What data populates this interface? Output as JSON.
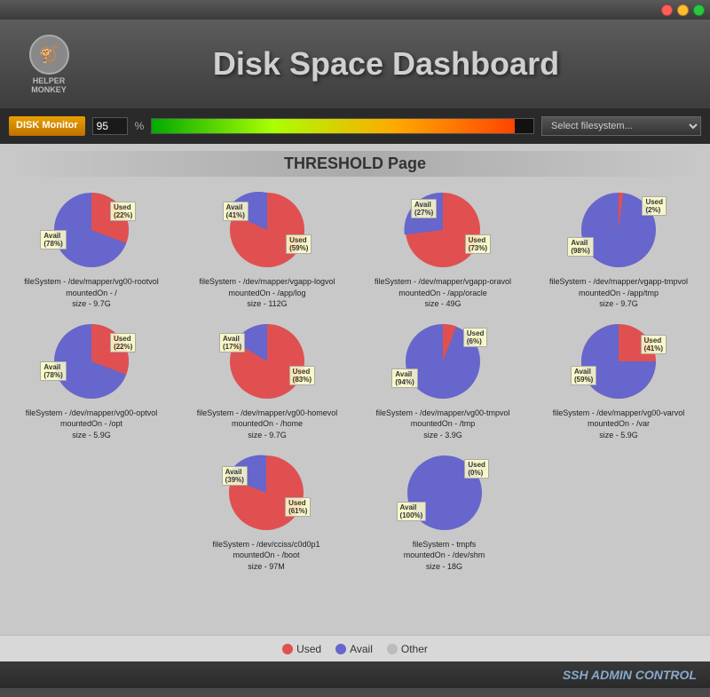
{
  "window": {
    "title": "Disk Space Dashboard"
  },
  "header": {
    "logo_text": "HELPER\nMONKEY",
    "title": "Disk Space Dashboard"
  },
  "toolbar": {
    "disk_monitor_label": "DISK\nMonitor",
    "threshold_value": "95",
    "threshold_unit": "%",
    "dropdown_placeholder": "Select filesystem...",
    "progress_pct": 95
  },
  "section_title": "THRESHOLD Page",
  "charts": [
    {
      "id": "chart1",
      "filesystem": "fileSystem - /dev/mapper/vg00-rootvol",
      "mounted_on": "mountedOn - /",
      "size": "size - 9.7G",
      "used_pct": 22,
      "avail_pct": 78,
      "other_pct": 0,
      "used_label_pos": {
        "top": "18%",
        "right": "10%"
      },
      "avail_label_pos": {
        "bottom": "28%",
        "left": "2%"
      }
    },
    {
      "id": "chart2",
      "filesystem": "fileSystem - /dev/mapper/vgapp-logvol",
      "mounted_on": "mountedOn - /app/log",
      "size": "size - 112G",
      "used_pct": 59,
      "avail_pct": 41,
      "other_pct": 0,
      "used_label_pos": {
        "top": "55%",
        "right": "8%"
      },
      "avail_label_pos": {
        "top": "18%",
        "left": "8%"
      }
    },
    {
      "id": "chart3",
      "filesystem": "fileSystem - /dev/mapper/vgapp-oravol",
      "mounted_on": "mountedOn - /app/oracle",
      "size": "size - 49G",
      "used_pct": 73,
      "avail_pct": 27,
      "other_pct": 0,
      "used_label_pos": {
        "top": "55%",
        "right": "5%"
      },
      "avail_label_pos": {
        "top": "15%",
        "left": "20%"
      }
    },
    {
      "id": "chart4",
      "filesystem": "fileSystem - /dev/mapper/vgapp-tmpvol",
      "mounted_on": "mountedOn - /app/tmp",
      "size": "size - 9.7G",
      "used_pct": 2,
      "avail_pct": 98,
      "other_pct": 0,
      "used_label_pos": {
        "top": "12%",
        "right": "5%"
      },
      "avail_label_pos": {
        "bottom": "20%",
        "left": "2%"
      }
    },
    {
      "id": "chart5",
      "filesystem": "fileSystem - /dev/mapper/vg00-optvol",
      "mounted_on": "mountedOn - /opt",
      "size": "size - 5.9G",
      "used_pct": 22,
      "avail_pct": 78,
      "other_pct": 0,
      "used_label_pos": {
        "top": "18%",
        "right": "8%"
      },
      "avail_label_pos": {
        "bottom": "28%",
        "left": "2%"
      }
    },
    {
      "id": "chart6",
      "filesystem": "fileSystem - /dev/mapper/vg00-homevol",
      "mounted_on": "mountedOn - /home",
      "size": "size - 9.7G",
      "used_pct": 83,
      "avail_pct": 17,
      "other_pct": 0,
      "used_label_pos": {
        "top": "55%",
        "right": "5%"
      },
      "avail_label_pos": {
        "top": "18%",
        "left": "5%"
      }
    },
    {
      "id": "chart7",
      "filesystem": "fileSystem - /dev/mapper/vg00-tmpvol",
      "mounted_on": "mountedOn - /tmp",
      "size": "size - 3.9G",
      "used_pct": 6,
      "avail_pct": 94,
      "other_pct": 0,
      "used_label_pos": {
        "top": "12%",
        "right": "8%"
      },
      "avail_label_pos": {
        "bottom": "20%",
        "left": "2%"
      }
    },
    {
      "id": "chart8",
      "filesystem": "fileSystem - /dev/mapper/vg00-varvol",
      "mounted_on": "mountedOn - /var",
      "size": "size - 5.9G",
      "used_pct": 41,
      "avail_pct": 59,
      "other_pct": 0,
      "used_label_pos": {
        "top": "20%",
        "right": "5%"
      },
      "avail_label_pos": {
        "top": "55%",
        "left": "5%"
      }
    },
    {
      "id": "chart9",
      "filesystem": "fileSystem - /dev/cciss/c0d0p1",
      "mounted_on": "mountedOn - /boot",
      "size": "size - 97M",
      "used_pct": 61,
      "avail_pct": 39,
      "other_pct": 0,
      "used_label_pos": {
        "top": "55%",
        "right": "8%"
      },
      "avail_label_pos": {
        "top": "20%",
        "left": "8%"
      }
    },
    {
      "id": "chart10",
      "filesystem": "fileSystem - tmpfs",
      "mounted_on": "mountedOn - /dev/shm",
      "size": "size - 18G",
      "used_pct": 0,
      "avail_pct": 100,
      "other_pct": 0,
      "used_label_pos": {
        "top": "12%",
        "right": "8%"
      },
      "avail_label_pos": {
        "bottom": "18%",
        "left": "5%"
      }
    }
  ],
  "legend": {
    "items": [
      {
        "label": "Used",
        "color": "#e05050"
      },
      {
        "label": "Avail",
        "color": "#6666cc"
      },
      {
        "label": "Other",
        "color": "#bbbbbb"
      }
    ]
  },
  "footer": {
    "text": "SSH ADMIN CONTROL"
  },
  "colors": {
    "used": "#e05050",
    "avail": "#6666cc",
    "other": "#bbbbbb"
  }
}
